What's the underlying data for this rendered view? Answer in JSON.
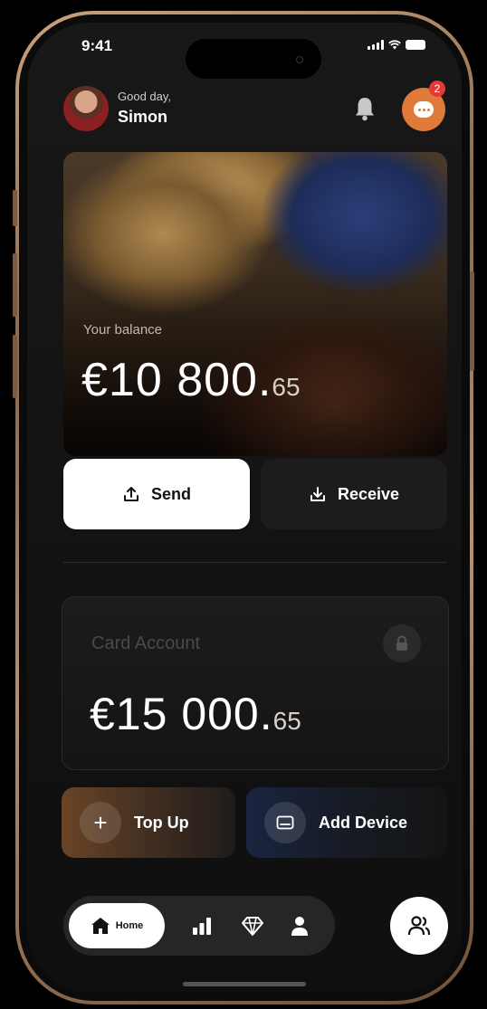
{
  "status": {
    "time": "9:41"
  },
  "header": {
    "greeting": "Good day,",
    "user_name": "Simon",
    "notification_count": "2"
  },
  "balance": {
    "label": "Your balance",
    "amount_main": "€10 800.",
    "amount_cents": "65"
  },
  "actions": {
    "send_label": "Send",
    "receive_label": "Receive"
  },
  "card_account": {
    "label": "Card Account",
    "amount_main": "€15 000.",
    "amount_cents": "65"
  },
  "quick_actions": {
    "top_up_label": "Top Up",
    "add_device_label": "Add Device"
  },
  "tabbar": {
    "home_label": "Home",
    "tabs": [
      "home-icon",
      "stats-icon",
      "diamond-icon",
      "profile-icon"
    ]
  },
  "colors": {
    "accent_orange": "#e07a3a",
    "badge_red": "#e53935",
    "frame_gold": "#c9a27c"
  }
}
